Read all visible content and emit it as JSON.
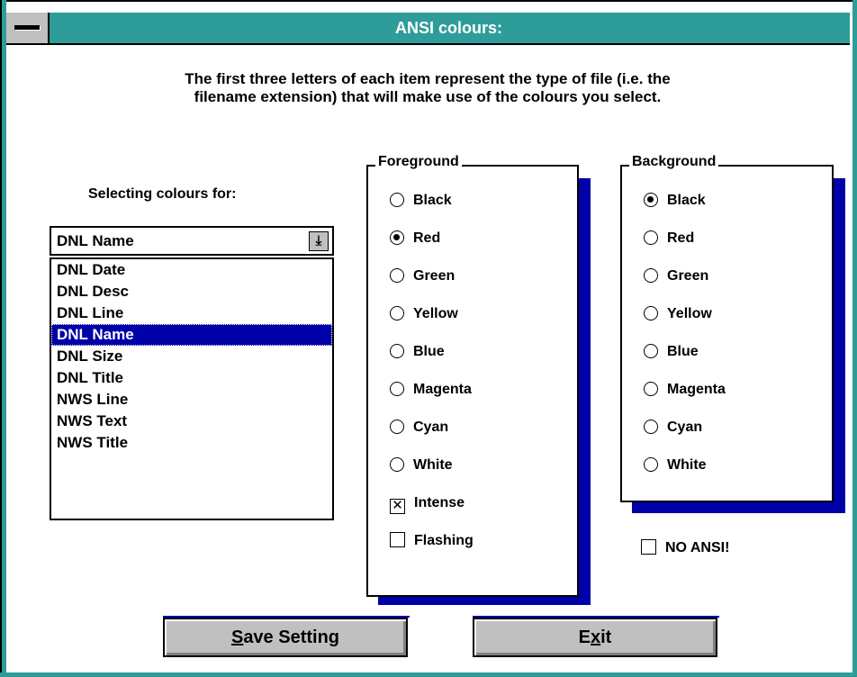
{
  "window": {
    "title": "ANSI colours:"
  },
  "intro": "The first three letters of each item represent the type of file (i.e. the\nfilename extension) that will make use of the colours you select.",
  "selector": {
    "label": "Selecting colours for:",
    "value": "DNL Name",
    "dropdown_icon": "arrow-down-icon",
    "items": [
      "DNL Date",
      "DNL Desc",
      "DNL Line",
      "DNL Name",
      "DNL Size",
      "DNL Title",
      "NWS Line",
      "NWS Text",
      "NWS Title"
    ],
    "selected_index": 3
  },
  "foreground": {
    "label": "Foreground",
    "options": [
      "Black",
      "Red",
      "Green",
      "Yellow",
      "Blue",
      "Magenta",
      "Cyan",
      "White"
    ],
    "selected": "Red",
    "intense": {
      "label": "Intense",
      "checked": true
    },
    "flashing": {
      "label": "Flashing",
      "checked": false
    }
  },
  "background": {
    "label": "Background",
    "options": [
      "Black",
      "Red",
      "Green",
      "Yellow",
      "Blue",
      "Magenta",
      "Cyan",
      "White"
    ],
    "selected": "Black"
  },
  "no_ansi": {
    "label": "NO ANSI!",
    "checked": false
  },
  "buttons": {
    "save": {
      "mnemonic": "S",
      "rest": "ave Setting"
    },
    "exit": {
      "pre": "E",
      "mnemonic": "x",
      "rest": "it"
    }
  },
  "colors": {
    "titlebar": "#2e9d9a",
    "accent": "#0000a8",
    "button": "#c0c0c0"
  }
}
